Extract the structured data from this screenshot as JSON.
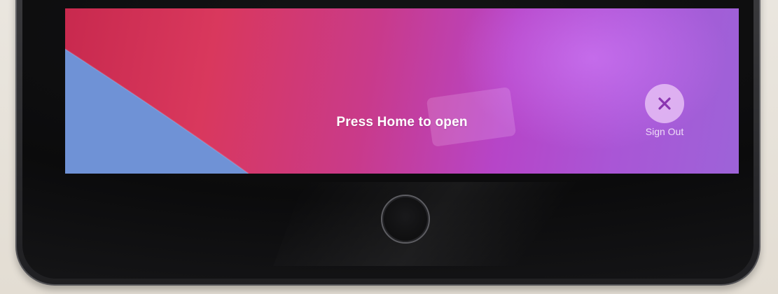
{
  "lock_screen": {
    "prompt_text": "Press Home to open",
    "sign_out": {
      "label": "Sign Out",
      "icon": "close-icon"
    }
  },
  "device": {
    "home_button": "home-button"
  },
  "colors": {
    "wallpaper_red": "#c8294e",
    "wallpaper_purple": "#a956d6",
    "wallpaper_blue": "#6f92d6",
    "signout_button_bg": "#e6bef5",
    "signout_icon": "#8a35b0"
  }
}
